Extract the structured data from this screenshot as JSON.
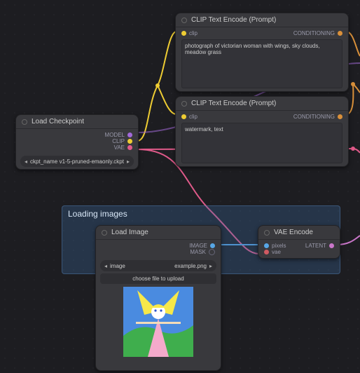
{
  "group": {
    "title": "Loading images"
  },
  "nodes": {
    "load_checkpoint": {
      "title": "Load Checkpoint",
      "outputs": [
        "MODEL",
        "CLIP",
        "VAE"
      ],
      "widgets": {
        "ckpt_name_label": "ckpt_name",
        "ckpt_name_value": "v1-5-pruned-emaonly.ckpt"
      }
    },
    "clip_pos": {
      "title": "CLIP Text Encode (Prompt)",
      "input": "clip",
      "output": "CONDITIONING",
      "text": "photograph of victorian woman with wings, sky clouds, meadow grass"
    },
    "clip_neg": {
      "title": "CLIP Text Encode (Prompt)",
      "input": "clip",
      "output": "CONDITIONING",
      "text": "watermark, text"
    },
    "load_image": {
      "title": "Load Image",
      "outputs": [
        "IMAGE",
        "MASK"
      ],
      "widgets": {
        "image_label": "image",
        "image_value": "example.png",
        "upload_btn": "choose file to upload"
      }
    },
    "vae_encode": {
      "title": "VAE Encode",
      "inputs": [
        "pixels",
        "vae"
      ],
      "output": "LATENT"
    }
  },
  "colors": {
    "model": "#a26ad9",
    "clip": "#eecc33",
    "vae": "#e05a8a",
    "cond": "#d9903a",
    "image": "#57a6e5",
    "latent": "#c976c9"
  }
}
